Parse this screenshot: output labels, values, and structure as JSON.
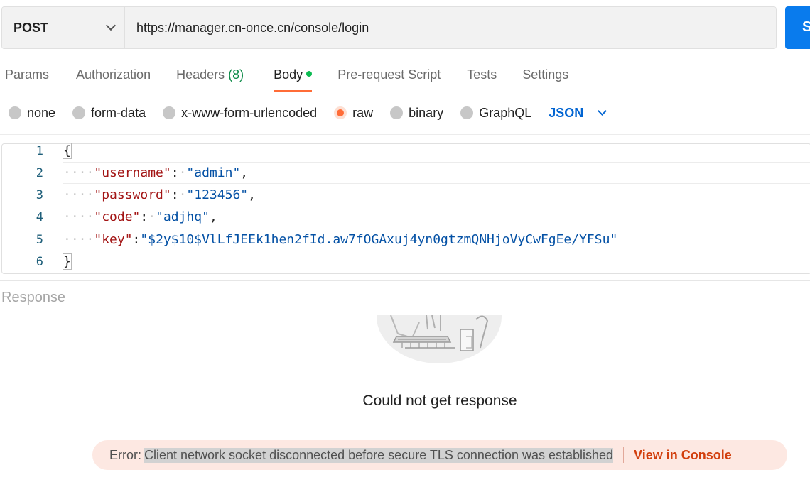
{
  "request": {
    "method": "POST",
    "url": "https://manager.cn-once.cn/console/login",
    "send_label": "S"
  },
  "tabs": [
    {
      "label": "Params"
    },
    {
      "label": "Authorization"
    },
    {
      "label": "Headers",
      "count": "(8)"
    },
    {
      "label": "Body",
      "active": true
    },
    {
      "label": "Pre-request Script"
    },
    {
      "label": "Tests"
    },
    {
      "label": "Settings"
    }
  ],
  "body_types": [
    {
      "label": "none"
    },
    {
      "label": "form-data"
    },
    {
      "label": "x-www-form-urlencoded"
    },
    {
      "label": "raw",
      "checked": true
    },
    {
      "label": "binary"
    },
    {
      "label": "GraphQL"
    }
  ],
  "format_select": "JSON",
  "editor": {
    "line_numbers": [
      "1",
      "2",
      "3",
      "4",
      "5",
      "6"
    ],
    "open_brace": "{",
    "close_brace": "}",
    "fields": [
      {
        "key": "\"username\"",
        "value": "\"admin\"",
        "comma": ","
      },
      {
        "key": "\"password\"",
        "value": "\"123456\"",
        "comma": ","
      },
      {
        "key": "\"code\"",
        "value": "\"adjhq\"",
        "comma": ","
      },
      {
        "key": "\"key\"",
        "value": "\"$2y$10$VlLfJEEk1hen2fId.aw7fOGAxuj4yn0gtzmQNHjoVyCwFgEe/YFSu\"",
        "comma": ""
      }
    ]
  },
  "response": {
    "title": "Response",
    "message": "Could not get response",
    "error_prefix": "Error:",
    "error_message": "Client network socket disconnected before secure TLS connection was established",
    "view_console": "View in Console"
  },
  "colors": {
    "accent_orange": "#ff6c37",
    "send_blue": "#097bed",
    "json_blue": "#0265d2",
    "status_green": "#0cbb52"
  }
}
